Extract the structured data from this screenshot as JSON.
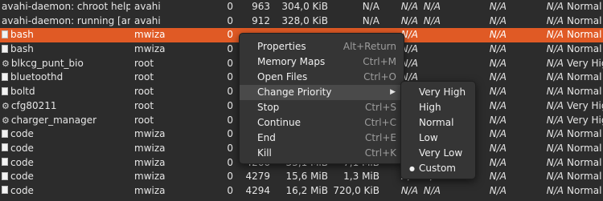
{
  "processes": [
    {
      "name": "avahi-daemon: chroot helper",
      "user": "avahi",
      "cpu": "0",
      "id": "963",
      "mem": "304,0 KiB",
      "dr": "N/A",
      "dw": "N/A",
      "dt": "N/A",
      "dw2": "N/A",
      "na4": "N/A",
      "pri": "Normal",
      "icon": "none"
    },
    {
      "name": "avahi-daemon: running [andiwa",
      "user": "avahi",
      "cpu": "0",
      "id": "912",
      "mem": "328,0 KiB",
      "dr": "N/A",
      "dw": "N/A",
      "dt": "N/A",
      "dw2": "N/A",
      "na4": "N/A",
      "pri": "Normal",
      "icon": "none"
    },
    {
      "name": "bash",
      "user": "mwiza",
      "cpu": "0",
      "id": "",
      "mem": "",
      "dr": "",
      "dw": "N/A",
      "dt": "",
      "dw2": "N/A",
      "na4": "N/A",
      "pri": "Normal",
      "icon": "doc",
      "selected": true
    },
    {
      "name": "bash",
      "user": "mwiza",
      "cpu": "0",
      "id": "",
      "mem": "",
      "dr": "",
      "dw": "N/A",
      "dt": "",
      "dw2": "N/A",
      "na4": "N/A",
      "pri": "Normal",
      "icon": "doc"
    },
    {
      "name": "blkcg_punt_bio",
      "user": "root",
      "cpu": "0",
      "id": "",
      "mem": "",
      "dr": "",
      "dw": "N/A",
      "dt": "",
      "dw2": "N/A",
      "na4": "N/A",
      "pri": "Very High",
      "icon": "gear"
    },
    {
      "name": "bluetoothd",
      "user": "root",
      "cpu": "0",
      "id": "",
      "mem": "",
      "dr": "",
      "dw": "N/A",
      "dt": "",
      "dw2": "N/A",
      "na4": "N/A",
      "pri": "Normal",
      "icon": "doc"
    },
    {
      "name": "boltd",
      "user": "root",
      "cpu": "0",
      "id": "",
      "mem": "",
      "dr": "",
      "dw": "N/A",
      "dt": "",
      "dw2": "N/A",
      "na4": "N/A",
      "pri": "Normal",
      "icon": "doc"
    },
    {
      "name": "cfg80211",
      "user": "root",
      "cpu": "0",
      "id": "",
      "mem": "",
      "dr": "",
      "dw": "N/A",
      "dt": "",
      "dw2": "N/A",
      "na4": "N/A",
      "pri": "Very High",
      "icon": "gear"
    },
    {
      "name": "charger_manager",
      "user": "root",
      "cpu": "0",
      "id": "",
      "mem": "",
      "dr": "",
      "dw": "N/A",
      "dt": "",
      "dw2": "N/A",
      "na4": "N/A",
      "pri": "Very High",
      "icon": "gear"
    },
    {
      "name": "code",
      "user": "mwiza",
      "cpu": "0",
      "id": "",
      "mem": "",
      "dr": "",
      "dw": "N/A",
      "dt": "",
      "dw2": "N/A",
      "na4": "N/A",
      "pri": "Normal",
      "icon": "doc"
    },
    {
      "name": "code",
      "user": "mwiza",
      "cpu": "0",
      "id": "",
      "mem": "",
      "dr": "",
      "dw": "N/A",
      "dt": "",
      "dw2": "N/A",
      "na4": "N/A",
      "pri": "Normal",
      "icon": "doc"
    },
    {
      "name": "code",
      "user": "mwiza",
      "cpu": "0",
      "id": "4266",
      "mem": "33,1 MiB",
      "dr": "7,1 MiB",
      "dw": "N/A",
      "dt": "",
      "dw2": "N/A",
      "na4": "N/A",
      "pri": "Normal",
      "icon": "doc"
    },
    {
      "name": "code",
      "user": "mwiza",
      "cpu": "0",
      "id": "4279",
      "mem": "15,6 MiB",
      "dr": "1,3 MiB",
      "dw": "N/A",
      "dt": "N/A",
      "dw2": "N/A",
      "na4": "N/A",
      "pri": "Normal",
      "icon": "doc"
    },
    {
      "name": "code",
      "user": "mwiza",
      "cpu": "0",
      "id": "4294",
      "mem": "16,2 MiB",
      "dr": "720,0 KiB",
      "dw": "N/A",
      "dt": "N/A",
      "dw2": "N/A",
      "na4": "N/A",
      "pri": "Normal",
      "icon": "doc"
    }
  ],
  "context_menu": {
    "items": [
      {
        "label": "Properties",
        "accel": "Alt+Return"
      },
      {
        "label": "Memory Maps",
        "accel": "Ctrl+M"
      },
      {
        "label": "Open Files",
        "accel": "Ctrl+O"
      },
      {
        "label": "Change Priority",
        "accel": "",
        "submenu": true
      },
      {
        "label": "Stop",
        "accel": "Ctrl+S"
      },
      {
        "label": "Continue",
        "accel": "Ctrl+C"
      },
      {
        "label": "End",
        "accel": "Ctrl+E"
      },
      {
        "label": "Kill",
        "accel": "Ctrl+K"
      }
    ]
  },
  "priority_submenu": {
    "items": [
      {
        "label": "Very High"
      },
      {
        "label": "High"
      },
      {
        "label": "Normal"
      },
      {
        "label": "Low"
      },
      {
        "label": "Very Low"
      },
      {
        "label": "Custom",
        "selected": true
      }
    ]
  },
  "colors": {
    "selection": "#e05a25",
    "background": "#2c2c2c",
    "menu": "#353535"
  }
}
